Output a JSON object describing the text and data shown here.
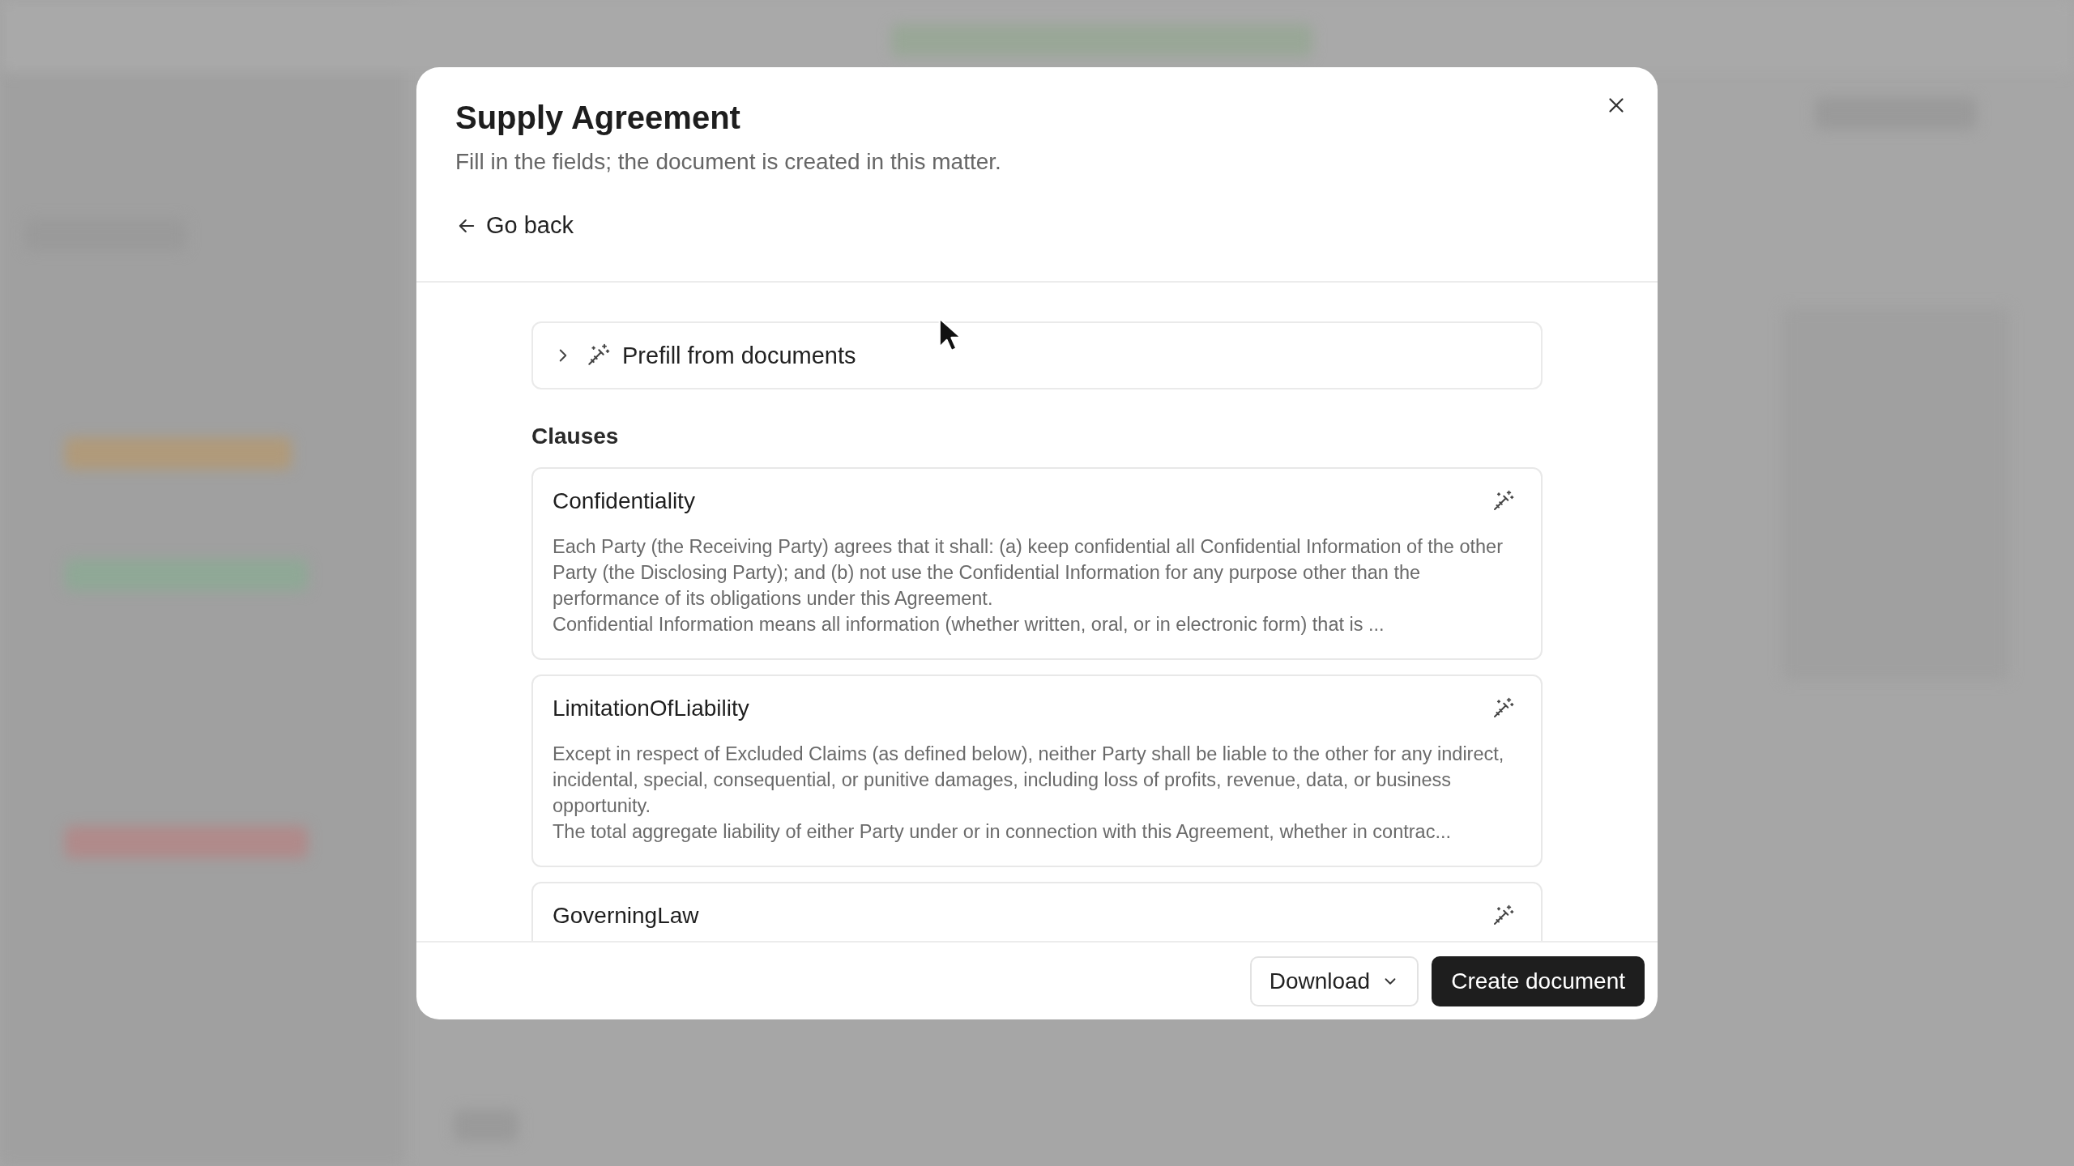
{
  "dialog": {
    "title": "Supply Agreement",
    "subtitle": "Fill in the fields; the document is created in this matter.",
    "back_link": "Go back"
  },
  "prefill": {
    "label": "Prefill from documents",
    "expanded": false
  },
  "clauses_heading": "Clauses",
  "clauses": [
    {
      "title": "Confidentiality",
      "paragraphs": [
        "Each Party (the Receiving Party) agrees that it shall: (a) keep confidential all Confidential Information of the other Party (the Disclosing Party); and (b) not use the Confidential Information for any purpose other than the performance of its obligations under this Agreement.",
        "Confidential Information means all information (whether written, oral, or in electronic form) that is ..."
      ]
    },
    {
      "title": "LimitationOfLiability",
      "paragraphs": [
        "Except in respect of Excluded Claims (as defined below), neither Party shall be liable to the other for any indirect, incidental, special, consequential, or punitive damages, including loss of profits, revenue, data, or business opportunity.",
        "The total aggregate liability of either Party under or in connection with this Agreement, whether in contrac..."
      ]
    },
    {
      "title": "GoverningLaw"
    }
  ],
  "footer": {
    "download_button": "Download",
    "create_button": "Create document"
  }
}
